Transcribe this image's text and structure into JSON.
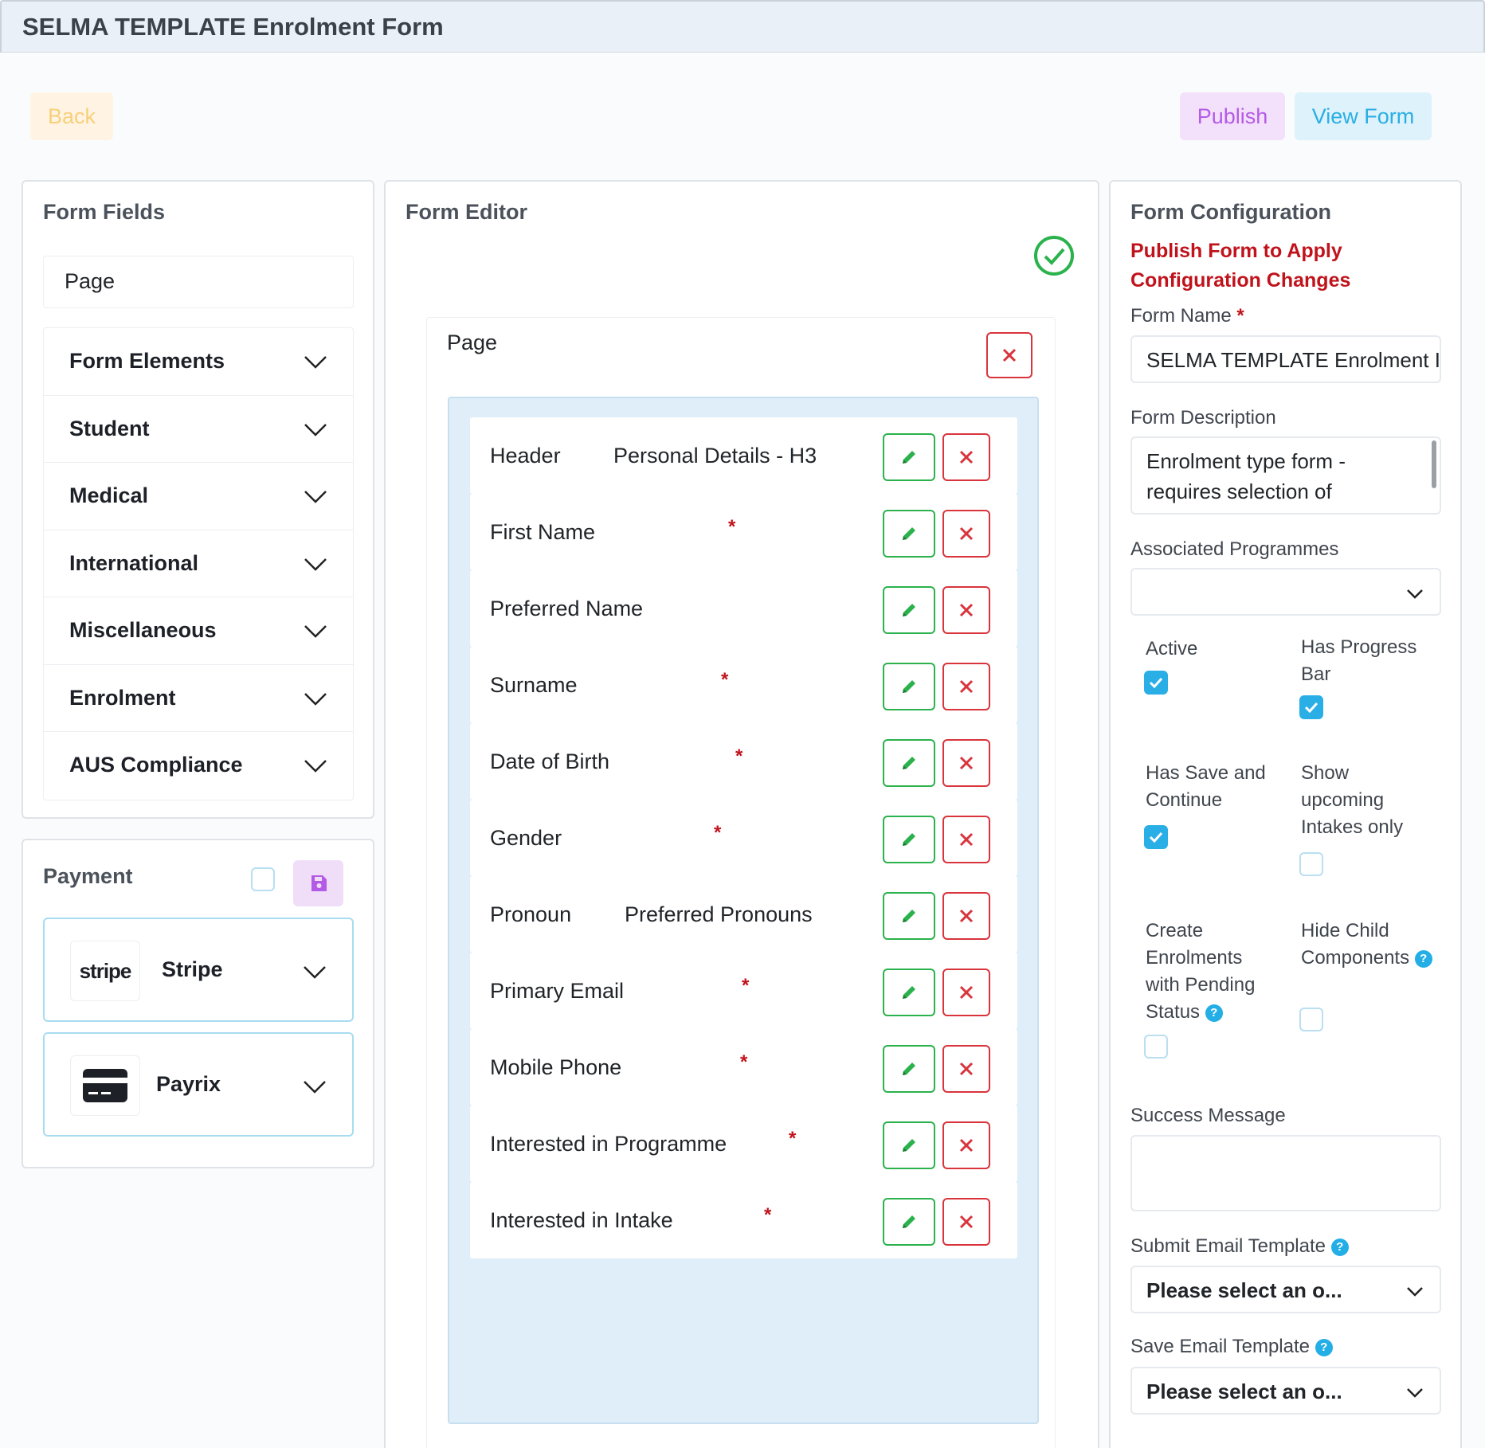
{
  "window": {
    "title": "SELMA TEMPLATE Enrolment Form"
  },
  "toolbar": {
    "back_label": "Back",
    "publish_label": "Publish",
    "view_form_label": "View Form"
  },
  "form_fields": {
    "title": "Form Fields",
    "page_item": "Page",
    "groups": [
      "Form Elements",
      "Student",
      "Medical",
      "International",
      "Miscellaneous",
      "Enrolment",
      "AUS Compliance"
    ]
  },
  "payment": {
    "title": "Payment",
    "checked": false,
    "providers": [
      {
        "name": "Stripe",
        "logo_text": "stripe",
        "icon": "stripe-logo-icon"
      },
      {
        "name": "Payrix",
        "icon": "credit-card-icon"
      }
    ]
  },
  "editor": {
    "title": "Form Editor",
    "status_icon": "check-circle-icon",
    "page_label": "Page",
    "fields": [
      {
        "label": "Header",
        "sub": "Personal Details - H3",
        "required": false
      },
      {
        "label": "First Name",
        "sub": "",
        "required": true
      },
      {
        "label": "Preferred Name",
        "sub": "",
        "required": false
      },
      {
        "label": "Surname",
        "sub": "",
        "required": true
      },
      {
        "label": "Date of Birth",
        "sub": "",
        "required": true
      },
      {
        "label": "Gender",
        "sub": "",
        "required": true
      },
      {
        "label": "Pronoun",
        "sub": "Preferred Pronouns",
        "required": false
      },
      {
        "label": "Primary Email",
        "sub": "",
        "required": true
      },
      {
        "label": "Mobile Phone",
        "sub": "",
        "required": true
      },
      {
        "label": "Interested in Programme",
        "sub": "",
        "required": true
      },
      {
        "label": "Interested in Intake",
        "sub": "",
        "required": true
      }
    ],
    "required_mark": "*"
  },
  "config": {
    "title": "Form Configuration",
    "warning": "Publish Form to Apply Configuration Changes",
    "form_name_label": "Form Name",
    "form_name_value": "SELMA TEMPLATE Enrolment I",
    "form_description_label": "Form Description",
    "form_description_value": "Enrolment type form - requires selection of",
    "associated_programmes_label": "Associated Programmes",
    "associated_programmes_value": "",
    "options": [
      {
        "label": "Active",
        "checked": true,
        "help": false
      },
      {
        "label": "Has Progress Bar",
        "checked": true,
        "help": false
      },
      {
        "label": "Has Save and Continue",
        "checked": true,
        "help": false
      },
      {
        "label": "Show upcoming Intakes only",
        "checked": false,
        "help": false
      },
      {
        "label": "Create Enrolments with Pending Status",
        "checked": false,
        "help": true
      },
      {
        "label": "Hide Child Components",
        "checked": false,
        "help": true
      }
    ],
    "success_message_label": "Success Message",
    "success_message_value": "",
    "submit_email_label": "Submit Email Template",
    "submit_email_value": "Please select an o...",
    "save_email_label": "Save Email Template",
    "save_email_value": "Please select an o...",
    "help_glyph": "?",
    "required_mark": "*"
  },
  "colors": {
    "accent_blue": "#2aaee6",
    "danger": "#d9343c",
    "success": "#2bb24c",
    "publish_purple": "#b45be6",
    "back_orange": "#f8cf7a"
  }
}
